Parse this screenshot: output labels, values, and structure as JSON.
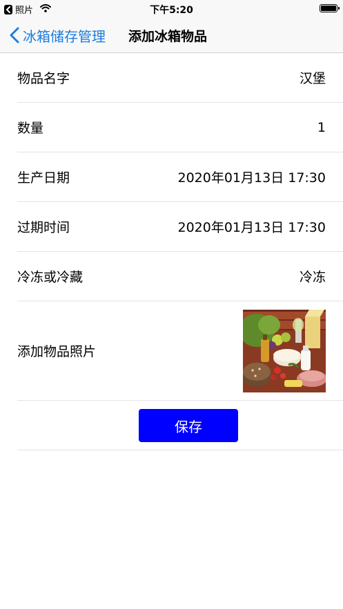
{
  "status_bar": {
    "back_app_label": "照片",
    "time": "下午5:20"
  },
  "nav": {
    "back_label": "冰箱储存管理",
    "title": "添加冰箱物品"
  },
  "form": {
    "rows": [
      {
        "label": "物品名字",
        "value": "汉堡"
      },
      {
        "label": "数量",
        "value": "1"
      },
      {
        "label": "生产日期",
        "value": "2020年01月13日 17:30"
      },
      {
        "label": "过期时间",
        "value": "2020年01月13日 17:30"
      },
      {
        "label": "冷冻或冷藏",
        "value": "冷冻"
      }
    ],
    "photo_label": "添加物品照片",
    "save_label": "保存"
  },
  "colors": {
    "accent_blue": "#1a7de0",
    "save_button": "#0000ff"
  }
}
